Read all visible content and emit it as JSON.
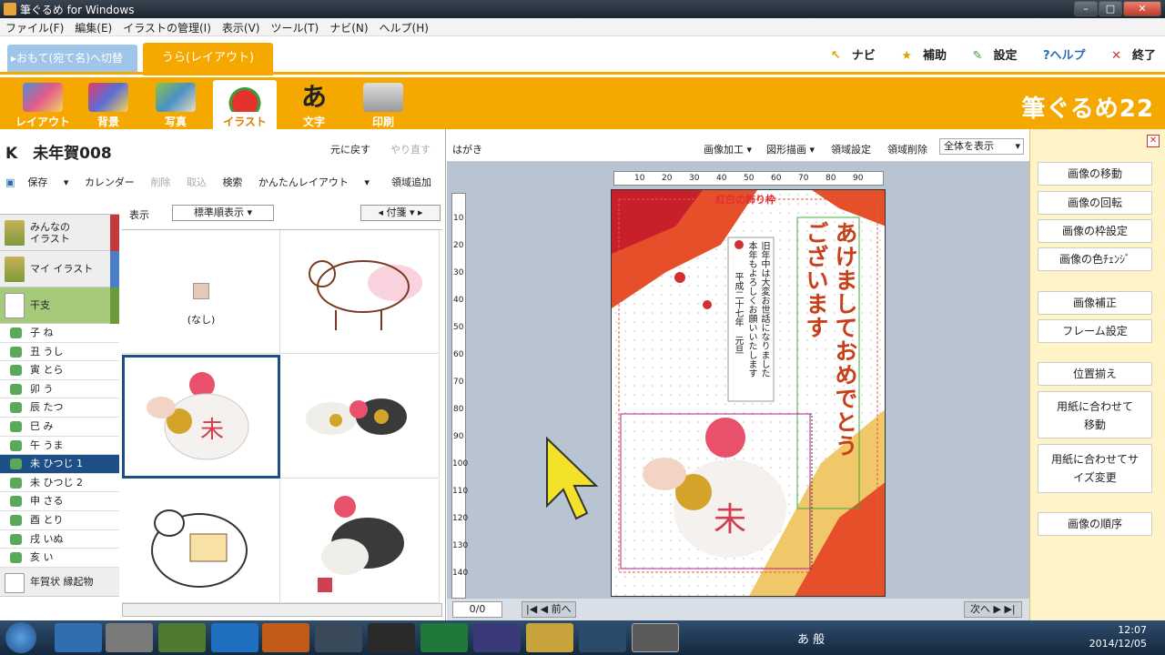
{
  "window": {
    "title": "筆ぐるめ for Windows"
  },
  "menu": [
    "ファイル(F)",
    "編集(E)",
    "イラストの管理(I)",
    "表示(V)",
    "ツール(T)",
    "ナビ(N)",
    "ヘルプ(H)"
  ],
  "tabs": {
    "front": "▸おもて(宛て名)へ切替",
    "back": "うら(レイアウト)"
  },
  "top_links": {
    "navi": "ナビ",
    "assist": "補助",
    "settings": "設定",
    "help": "?ヘルプ",
    "exit": "終了"
  },
  "toolbar": {
    "items": [
      "レイアウト",
      "背景",
      "写真",
      "イラスト",
      "文字",
      "印刷"
    ],
    "brand": "筆ぐるめ22"
  },
  "left": {
    "doc_title": "K　未年賀008",
    "undo": "元に戻す",
    "redo": "やり直す",
    "tools": {
      "save": "保存",
      "calendar": "カレンダー",
      "delete": "削除",
      "import": "取込",
      "search": "検索",
      "easy_layout": "かんたんレイアウト",
      "add_region": "領域追加"
    },
    "display_label": "表示",
    "sort_select": "標準順表示",
    "tag_label": "付箋",
    "categories": {
      "everyone": "みんなの\nイラスト",
      "mine": "マイ イラスト",
      "eto": "干支",
      "items": [
        "子 ね",
        "丑 うし",
        "寅 とら",
        "卯 う",
        "辰 たつ",
        "巳 み",
        "午 うま",
        "未 ひつじ 1",
        "未 ひつじ 2",
        "申 さる",
        "酉 とり",
        "戌 いぬ",
        "亥 い"
      ],
      "selected_index": 7,
      "last": "年賀状 縁起物"
    },
    "none_label": "(なし)"
  },
  "center": {
    "hagaki": "はがき",
    "actions": {
      "image_proc": "画像加工",
      "shape": "図形描画",
      "region_settings": "領域設定",
      "region_delete": "領域削除"
    },
    "view_select": "全体を表示",
    "pager": {
      "count": "0/0",
      "prev": "前へ",
      "next": "次へ"
    },
    "card": {
      "greeting": "あけましておめでとうございます",
      "greeting_line1": "あけましておめでとう",
      "greeting_line2": "ございます",
      "message": "旧年中は大変お世話になりました本年もよろしくお願いいたします",
      "message_line1": "旧年中は大変お世話になりました",
      "message_line2": "本年もよろしくお願いいたします",
      "date_line": "平成二十七年　元旦",
      "frame_label": "紅白の飾り枠",
      "kanji": "未"
    },
    "ruler_h": [
      "10",
      "20",
      "30",
      "40",
      "50",
      "60",
      "70",
      "80",
      "90"
    ],
    "ruler_v": [
      "10",
      "20",
      "30",
      "40",
      "50",
      "60",
      "70",
      "80",
      "90",
      "100",
      "110",
      "120",
      "130",
      "140"
    ]
  },
  "right": {
    "buttons": [
      "画像の移動",
      "画像の回転",
      "画像の枠設定",
      "画像の色ﾁｪﾝｼﾞ",
      "画像補正",
      "フレーム設定",
      "位置揃え",
      "用紙に合わせて移動",
      "用紙に合わせてサイズ変更",
      "画像の順序"
    ]
  },
  "taskbar": {
    "time": "12:07",
    "date": "2014/12/05",
    "ime": "あ 般"
  }
}
